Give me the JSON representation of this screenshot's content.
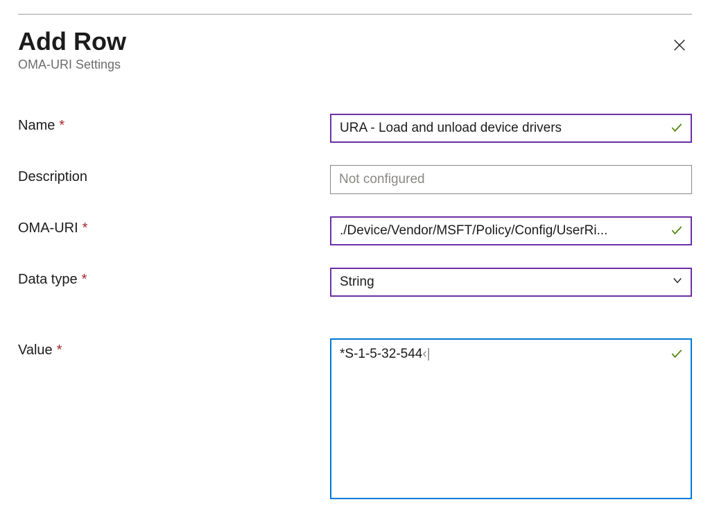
{
  "header": {
    "title": "Add Row",
    "subtitle": "OMA-URI Settings"
  },
  "labels": {
    "name": "Name",
    "description": "Description",
    "oma_uri": "OMA-URI",
    "data_type": "Data type",
    "value": "Value",
    "required_marker": "*"
  },
  "fields": {
    "name": "URA - Load and unload device drivers",
    "description_placeholder": "Not configured",
    "oma_uri": "./Device/Vendor/MSFT/Policy/Config/UserRi...",
    "data_type": "String",
    "value": "*S-1-5-32-544"
  },
  "colors": {
    "purple_border": "#6b2fa5",
    "blue_border": "#0078d4",
    "check_green": "#498205",
    "required_red": "#a4262c"
  }
}
